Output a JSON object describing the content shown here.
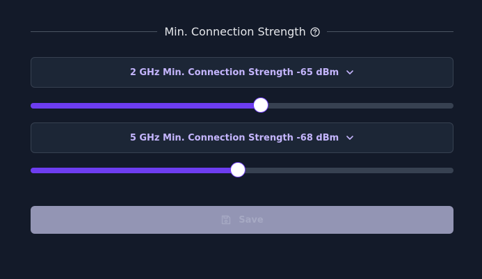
{
  "section": {
    "title": "Min. Connection Strength",
    "help_icon": "question-circle-icon"
  },
  "band_2ghz": {
    "label": "2 GHz Min. Connection Strength -65 dBm",
    "icon": "chevron-down-icon",
    "slider_fraction": 0.545
  },
  "band_5ghz": {
    "label": "5 GHz Min. Connection Strength -68 dBm",
    "icon": "chevron-down-icon",
    "slider_fraction": 0.49
  },
  "save": {
    "label": "Save",
    "icon": "floppy-disk-icon",
    "disabled": true
  },
  "colors": {
    "background": "#131a29",
    "accent": "#6d3df0",
    "dropdown_text": "#c4b5fd",
    "save_disabled": "#9395b4"
  }
}
